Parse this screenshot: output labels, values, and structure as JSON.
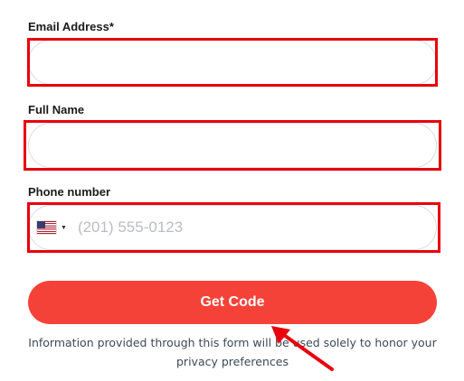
{
  "form": {
    "email": {
      "label": "Email Address*",
      "value": ""
    },
    "full_name": {
      "label": "Full Name",
      "value": ""
    },
    "phone": {
      "label": "Phone number",
      "country_icon": "us-flag-icon",
      "placeholder": "(201) 555-0123",
      "value": ""
    },
    "submit_label": "Get Code",
    "disclaimer": "Information provided through this form will be used solely to honor your privacy preferences"
  },
  "colors": {
    "button": "#f54238",
    "highlight": "#e8000b",
    "annotation_arrow": "#e8000b"
  }
}
